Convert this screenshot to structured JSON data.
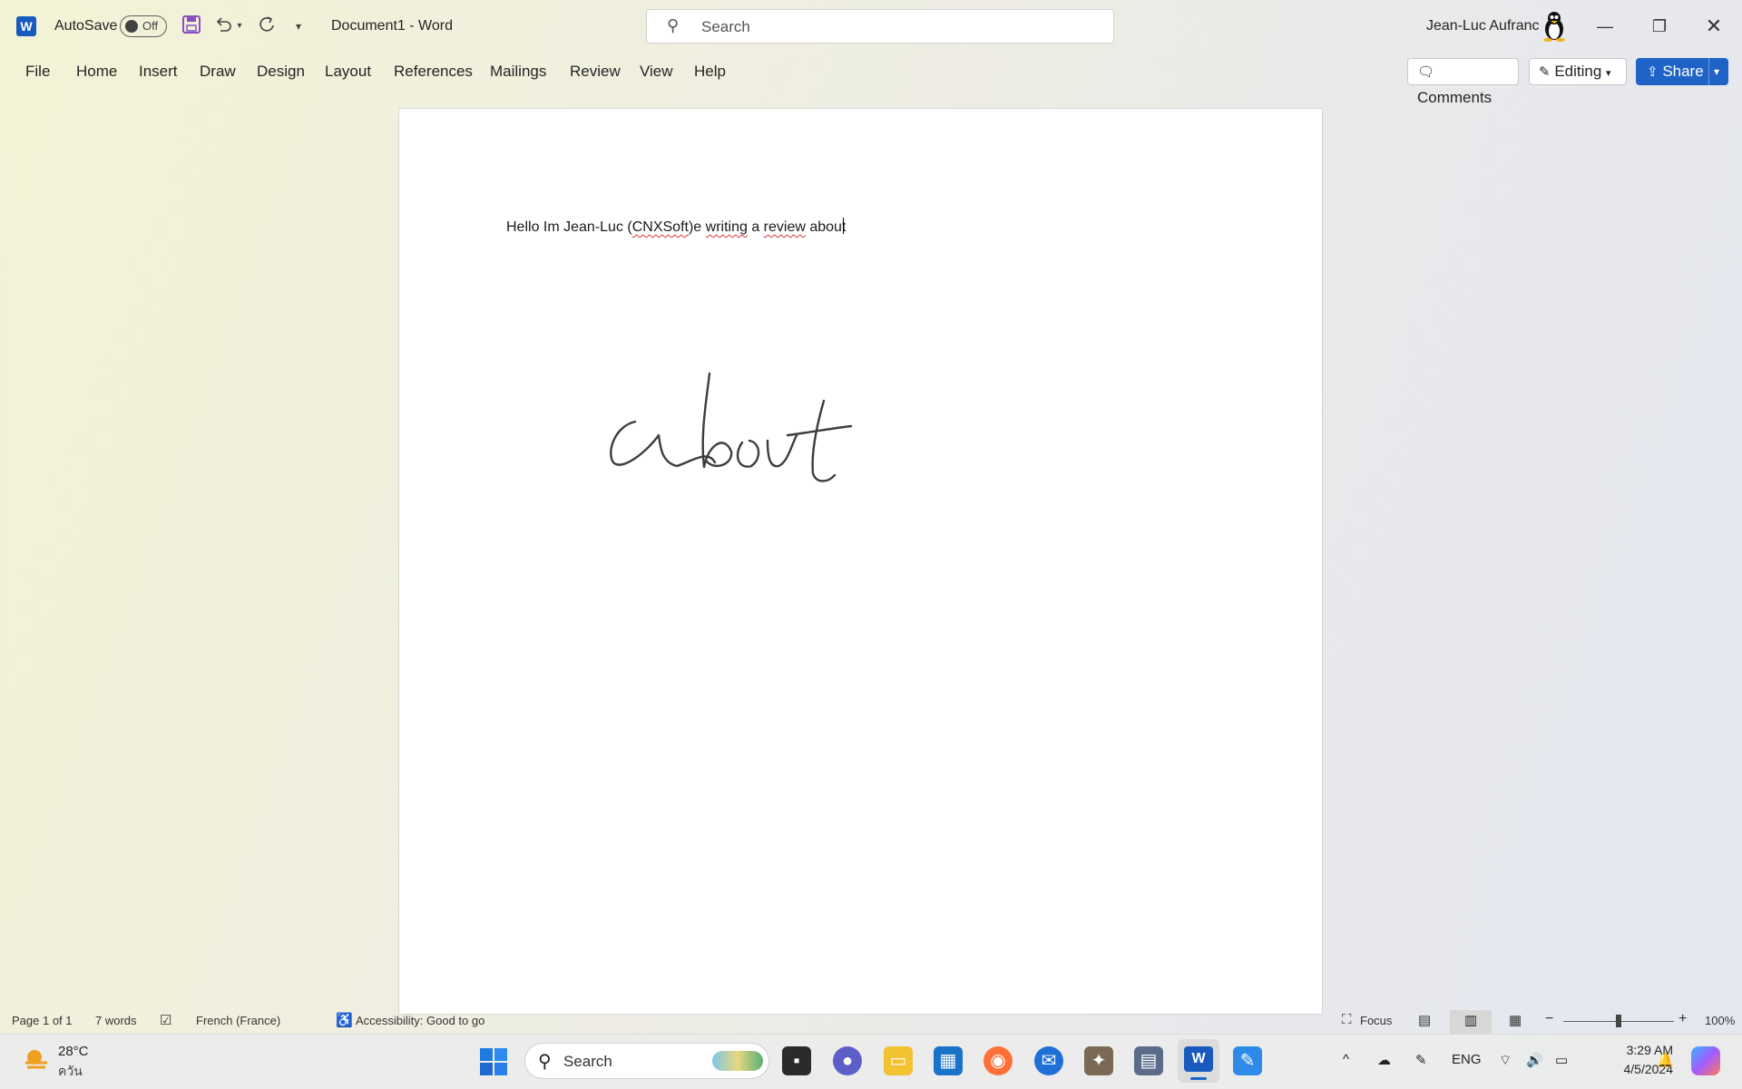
{
  "titlebar": {
    "app_logo": "W",
    "autosave_label": "AutoSave",
    "autosave_state": "Off",
    "doc_title": "Document1  -  Word",
    "search_placeholder": "Search",
    "user_name": "Jean-Luc Aufranc",
    "icons": [
      "save-icon",
      "undo-icon",
      "redo-icon",
      "customize-qat-icon",
      "minimize-icon",
      "restore-icon",
      "close-icon"
    ]
  },
  "ribbon": {
    "tabs": [
      "File",
      "Home",
      "Insert",
      "Draw",
      "Design",
      "Layout",
      "References",
      "Mailings",
      "Review",
      "View",
      "Help"
    ],
    "comments_label": "Comments",
    "editing_label": "Editing",
    "share_label": "Share"
  },
  "document": {
    "seg1": "Hello Im Jean-Luc (",
    "seg2": "CNXSoft",
    "seg3": ")e ",
    "seg4": "writing",
    "seg5": " a ",
    "seg6": "review",
    "seg7": " about",
    "ink_word": "about"
  },
  "statusbar": {
    "page": "Page 1 of 1",
    "words": "7 words",
    "language": "French (France)",
    "accessibility": "Accessibility: Good to go",
    "focus": "Focus",
    "zoom": "100%",
    "zoom_level": 1.0
  },
  "taskbar": {
    "weather_temp": "28°C",
    "weather_desc": "ควัน",
    "search_placeholder": "Search",
    "lang": "ENG",
    "time": "3:29 AM",
    "date": "4/5/2024"
  },
  "colors": {
    "word_blue": "#185abd",
    "share_blue": "#1f63c7",
    "spell_red": "#d13438"
  }
}
